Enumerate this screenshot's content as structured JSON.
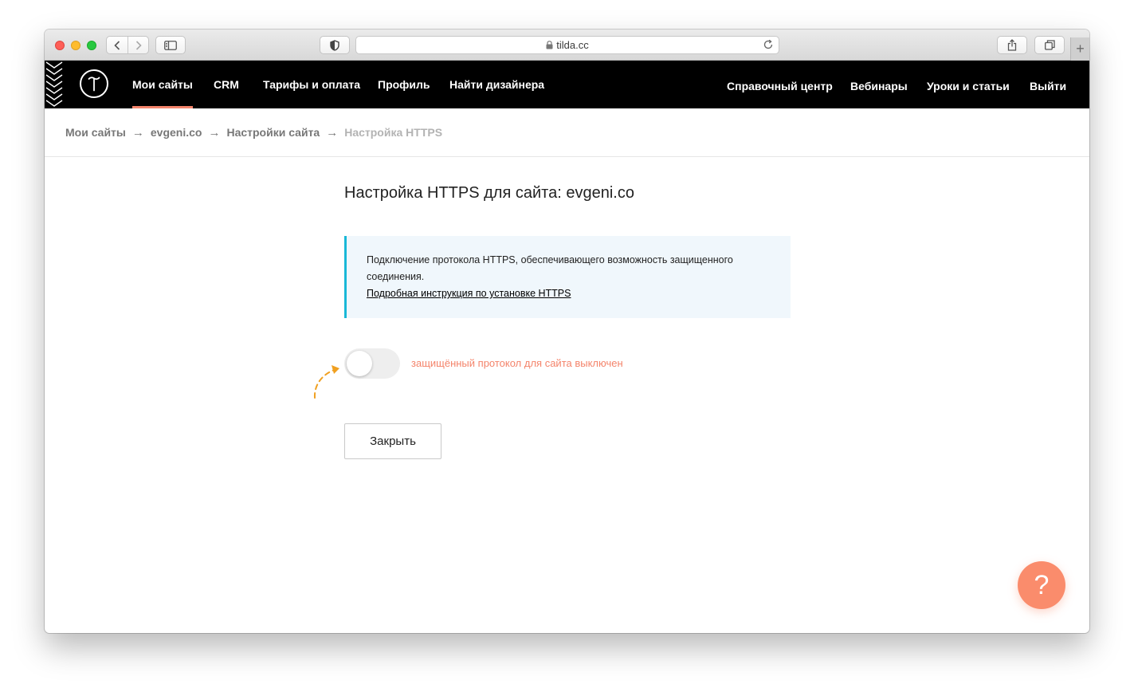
{
  "browser": {
    "url": "tilda.cc",
    "colors": {
      "close": "#fe5f57",
      "minimize": "#febc2e",
      "zoom": "#28c840"
    }
  },
  "nav": {
    "logo_icon": "tilda-logo-icon",
    "left": [
      {
        "label": "Мои сайты",
        "active": true
      },
      {
        "label": "CRM"
      },
      {
        "label": "Тарифы и оплата"
      },
      {
        "label": "Профиль"
      },
      {
        "label": "Найти дизайнера"
      }
    ],
    "right": [
      {
        "label": "Справочный центр"
      },
      {
        "label": "Вебинары"
      },
      {
        "label": "Уроки и статьи"
      },
      {
        "label": "Выйти"
      }
    ],
    "active_color": "#f4846b"
  },
  "breadcrumbs": {
    "items": [
      "Мои сайты",
      "evgeni.co",
      "Настройки сайта",
      "Настройка HTTPS"
    ],
    "separator": "→"
  },
  "page": {
    "title": "Настройка HTTPS для сайта: evgeni.co",
    "info": {
      "text": "Подключение протокола HTTPS, обеспечивающего возможность защищенного соединения.",
      "link": "Подробная инструкция по установке HTTPS",
      "accent_color": "#19b8d7"
    },
    "toggle": {
      "on": false,
      "status": "защищённый протокол для сайта выключен",
      "status_color": "#f4846b"
    },
    "close_label": "Закрыть"
  },
  "help": {
    "label": "?",
    "color": "#fa8c6c"
  }
}
